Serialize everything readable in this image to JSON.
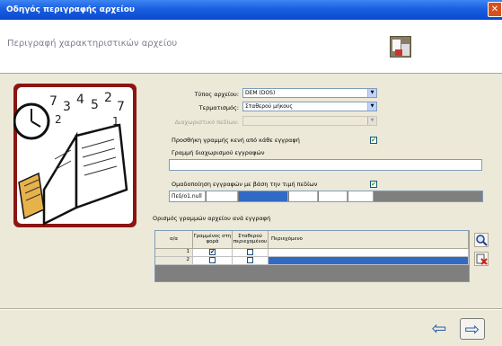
{
  "window": {
    "title": "Οδηγός περιγραφής αρχείου",
    "close_glyph": "✕"
  },
  "header": {
    "title": "Περιγραφή χαρακτηριστικών αρχείου",
    "icon": "documents-icon"
  },
  "form": {
    "file_type_label": "Τύπος αρχείου:",
    "file_type_value": "DEM (DOS)",
    "encoding_label": "Τερματισμός:",
    "encoding_value": "Σταθερού μήκους",
    "disabled_label": "Διαχωριστικό πεδίων:",
    "add_separator_label": "Προσθήκη γραμμής κενή από κάθε εγγραφή",
    "add_separator_checked": true,
    "line_label": "Γραμμή διαχωρισμού εγγραφών",
    "line_value": "",
    "fixed_length_label": "Ομαδοποίηση εγγραφών με βάση την τιμή πεδίων",
    "fixed_length_checked": true,
    "ruler_value": "Πεδ/ο1.null",
    "fields_label": "Ορισμός γραμμών αρχείου ανά εγγραφή"
  },
  "grid": {
    "headers": [
      "α/α",
      "Γραμμένος στη φορά",
      "Σταθερού περιεχομένου",
      "Περιεχόμενο"
    ],
    "rows": [
      {
        "num": "1",
        "c1": "✔",
        "c2": ""
      },
      {
        "num": "2",
        "c1": "",
        "c2": ""
      }
    ]
  },
  "side_buttons": [
    "zoom-icon",
    "delete-icon"
  ],
  "nav": {
    "back": "⇦",
    "next": "⇨"
  }
}
